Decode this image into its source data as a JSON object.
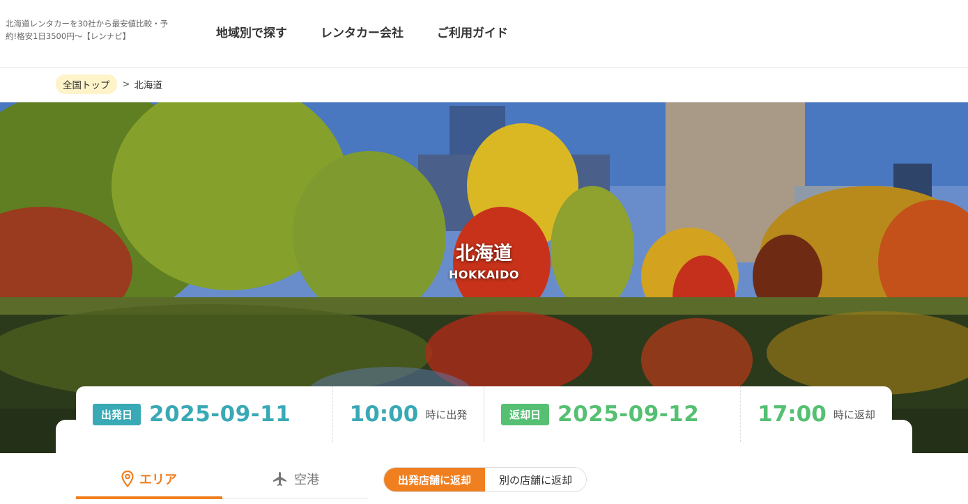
{
  "header": {
    "logo_text": "北海道レンタカーを30社から最安値比較・予約!格安1日3500円〜【レンナビ】",
    "nav": [
      {
        "label": "地域別で探す"
      },
      {
        "label": "レンタカー会社"
      },
      {
        "label": "ご利用ガイド"
      }
    ]
  },
  "breadcrumb": {
    "home": "全国トップ",
    "separator": ">",
    "current": "北海道"
  },
  "hero": {
    "title": "北海道",
    "subtitle": "HOKKAIDO"
  },
  "search": {
    "departure_badge": "出発日",
    "departure_date": "2025-09-11",
    "departure_time": "10:00",
    "departure_time_suffix": "時に出発",
    "return_badge": "返却日",
    "return_date": "2025-09-12",
    "return_time": "17:00",
    "return_time_suffix": "時に返却",
    "tabs": [
      {
        "label": "エリア",
        "icon": "map-pin-icon",
        "active": true
      },
      {
        "label": "空港",
        "icon": "airplane-icon",
        "active": false
      }
    ],
    "return_options": [
      {
        "label": "出発店舗に返却",
        "active": true
      },
      {
        "label": "別の店舗に返却",
        "active": false
      }
    ]
  },
  "colors": {
    "accent_orange": "#f07f20",
    "departure_blue": "#39a9b5",
    "return_green": "#55c072",
    "breadcrumb_bg": "#fff3c9"
  }
}
